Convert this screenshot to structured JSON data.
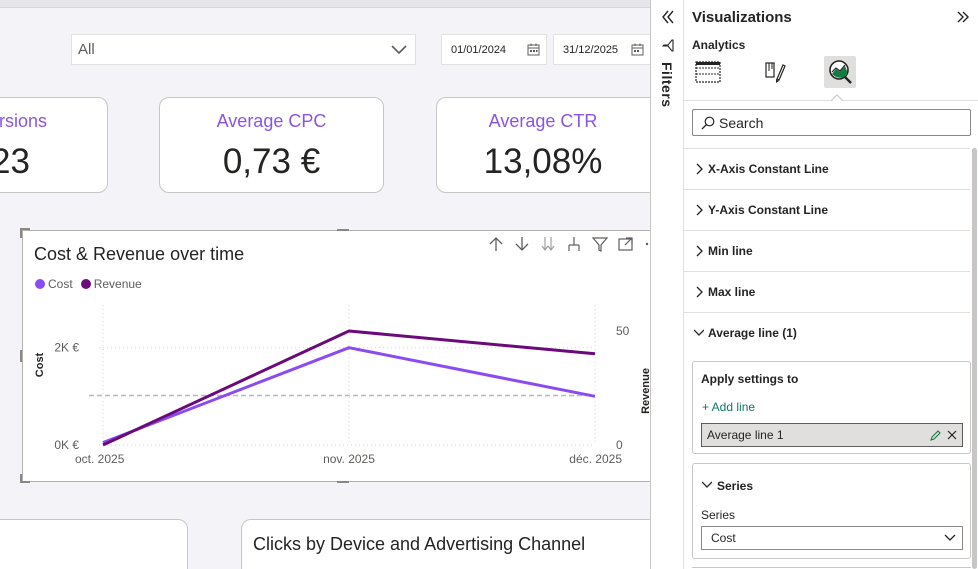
{
  "slicer": {
    "selected": "All"
  },
  "date_range": {
    "start": "01/01/2024",
    "end": "31/12/2025"
  },
  "kpis": [
    {
      "label": "rsions",
      "value": "23"
    },
    {
      "label": "Average CPC",
      "value": "0,73 €"
    },
    {
      "label": "Average CTR",
      "value": "13,08%"
    }
  ],
  "chart_data": {
    "type": "line",
    "title": "Cost & Revenue over time",
    "categories": [
      "oct. 2025",
      "nov. 2025",
      "déc. 2025"
    ],
    "series": [
      {
        "name": "Cost",
        "axis": "left",
        "color": "#8a4cf0",
        "values": [
          50,
          2000,
          1000
        ]
      },
      {
        "name": "Revenue",
        "axis": "right",
        "color": "#6b0a7a",
        "values": [
          0,
          50,
          40
        ]
      }
    ],
    "y_left": {
      "label": "Cost",
      "ylim": [
        0,
        3000
      ],
      "ticks": [
        {
          "v": 0,
          "t": "0K €"
        },
        {
          "v": 2000,
          "t": "2K €"
        }
      ]
    },
    "y_right": {
      "label": "Revenue",
      "ylim": [
        0,
        50
      ],
      "ticks": [
        {
          "v": 0,
          "t": "0"
        },
        {
          "v": 50,
          "t": "50"
        }
      ]
    },
    "average_line": {
      "series": "Cost",
      "value": 1017,
      "style": "dashed"
    },
    "grid": true,
    "legend": "top-left"
  },
  "bottom_cards": [
    {
      "title": ""
    },
    {
      "title": "Clicks by Device and Advertising Channel"
    }
  ],
  "filters_rail": {
    "label": "Filters"
  },
  "viz_pane": {
    "title": "Visualizations",
    "subtitle": "Analytics",
    "search_placeholder": "Search",
    "sections": [
      "X-Axis Constant Line",
      "Y-Axis Constant Line",
      "Min line",
      "Max line",
      "Average line (1)"
    ],
    "apply_settings": {
      "title": "Apply settings to",
      "add_line": "+ Add line",
      "line_name": "Average line 1"
    },
    "series_card": {
      "title": "Series",
      "field_label": "Series",
      "selected": "Cost"
    }
  },
  "colors": {
    "accent_purple": "#8a55e6",
    "cost": "#8a4cf0",
    "revenue": "#6b0a7a",
    "add_line_green": "#117865"
  }
}
